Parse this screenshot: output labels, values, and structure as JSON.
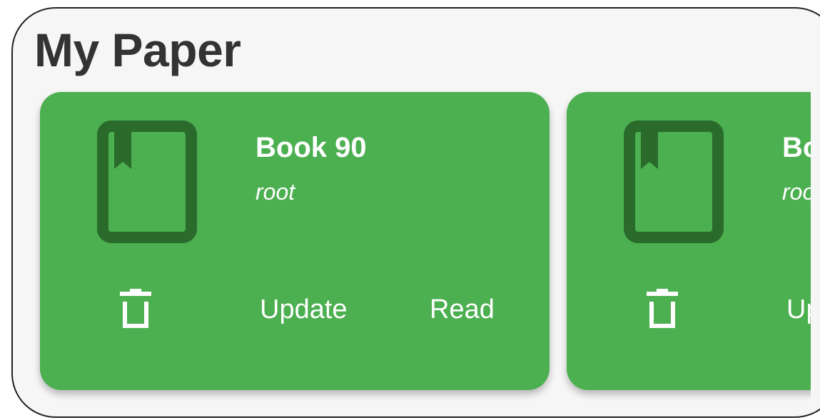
{
  "page": {
    "title": "My Paper"
  },
  "colors": {
    "card_background": "#4caf50",
    "icon_dark": "#2a6b2c",
    "text": "#ffffff",
    "title_text": "#333333"
  },
  "books": [
    {
      "title": "Book 90",
      "author": "root",
      "update_label": "Update",
      "read_label": "Read",
      "icon": "book-bookmark-icon",
      "delete_icon": "trash-icon"
    },
    {
      "title": "Bo",
      "author": "roo",
      "update_label": "Up",
      "icon": "book-bookmark-icon",
      "delete_icon": "trash-icon"
    }
  ]
}
